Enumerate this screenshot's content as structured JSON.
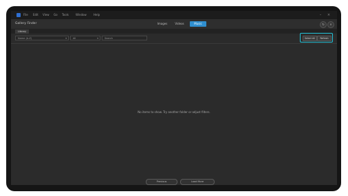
{
  "menu": {
    "items": [
      "File",
      "Edit",
      "View",
      "Go",
      "Tools",
      "Window",
      "Help"
    ]
  },
  "window": {
    "title": "Gallery Finder"
  },
  "modes": [
    "Images",
    "Videos",
    "Music"
  ],
  "tabs": [
    "Library"
  ],
  "filters": {
    "sort": "Name (A-Z)",
    "type": "All",
    "search_placeholder": "Search"
  },
  "toolbox": {
    "buttons": [
      "Select All",
      "Refresh"
    ]
  },
  "content": {
    "empty_message": "No items to show. Try another folder or adjust filters."
  },
  "pager": {
    "buttons": [
      "Previous",
      "Load More"
    ]
  },
  "colors": {
    "accent": "#2f8fd0",
    "highlight": "#23c3d9"
  }
}
